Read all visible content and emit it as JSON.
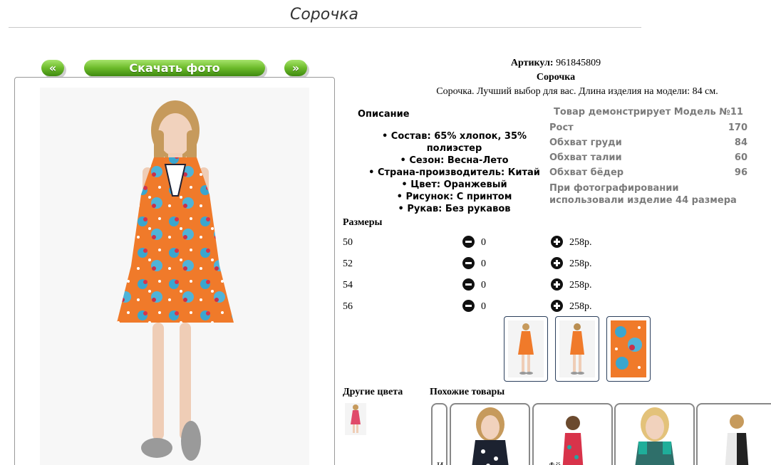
{
  "page": {
    "title": "Сорочка"
  },
  "nav": {
    "prev_label": "«",
    "download_label": "Скачать фото",
    "next_label": "»"
  },
  "product": {
    "article_label": "Артикул:",
    "article_value": "961845809",
    "name": "Сорочка",
    "description": "Сорочка. Лучший выбор для вас. Длина изделия на модели: 84 см."
  },
  "description": {
    "title": "Описание",
    "items": [
      "Состав: 65% хлопок, 35% полиэстер",
      "Сезон: Весна-Лето",
      "Страна-производитель: Китай",
      "Цвет: Оранжевый",
      "Рисунок: С принтом",
      "Рукав: Без рукавов"
    ]
  },
  "model": {
    "title": "Товар демонстрирует Модель №11",
    "rows": [
      {
        "label": "Рост",
        "value": "170"
      },
      {
        "label": "Обхват груди",
        "value": "84"
      },
      {
        "label": "Обхват талии",
        "value": "60"
      },
      {
        "label": "Обхват бёдер",
        "value": "96"
      }
    ],
    "note": "При фотографировании использовали изделие 44 размера"
  },
  "sizes": {
    "title": "Размеры",
    "rows": [
      {
        "size": "50",
        "qty": "0",
        "price": "258р."
      },
      {
        "size": "52",
        "qty": "0",
        "price": "258р."
      },
      {
        "size": "54",
        "qty": "0",
        "price": "258р."
      },
      {
        "size": "56",
        "qty": "0",
        "price": "258р."
      }
    ]
  },
  "other_colors": {
    "title": "Другие цвета"
  },
  "similar": {
    "title": "Похожие товары",
    "cut_caption": "И",
    "cut_text": "Ѣй"
  },
  "colors": {
    "button_green": "#6cba2a",
    "dress_orange": "#f07a2a",
    "thumb_border": "#2b3f5c",
    "model_text": "#7b7b7b"
  }
}
